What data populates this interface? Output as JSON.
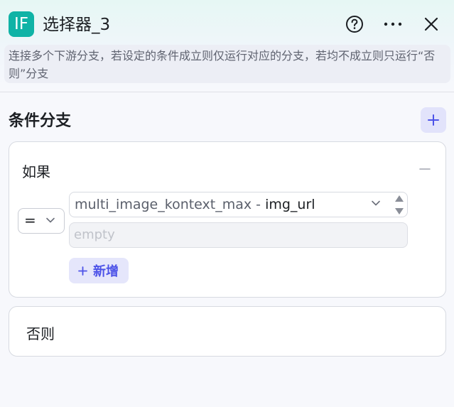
{
  "header": {
    "icon_text": "IF",
    "title": "选择器_3",
    "description": "连接多个下游分支，若设定的条件成立则仅运行对应的分支，若均不成立则只运行“否则”分支"
  },
  "branches": {
    "section_title": "条件分支",
    "if_label": "如果",
    "condition": {
      "operator": "=",
      "variable_node": "multi_image_kontext_max",
      "separator": "-",
      "variable_field": "img_url",
      "value_placeholder": "empty"
    },
    "add_condition_label": "新增",
    "else_label": "否则"
  },
  "colors": {
    "accent": "#4d53e8",
    "icon_bg": "#10b3a6"
  }
}
